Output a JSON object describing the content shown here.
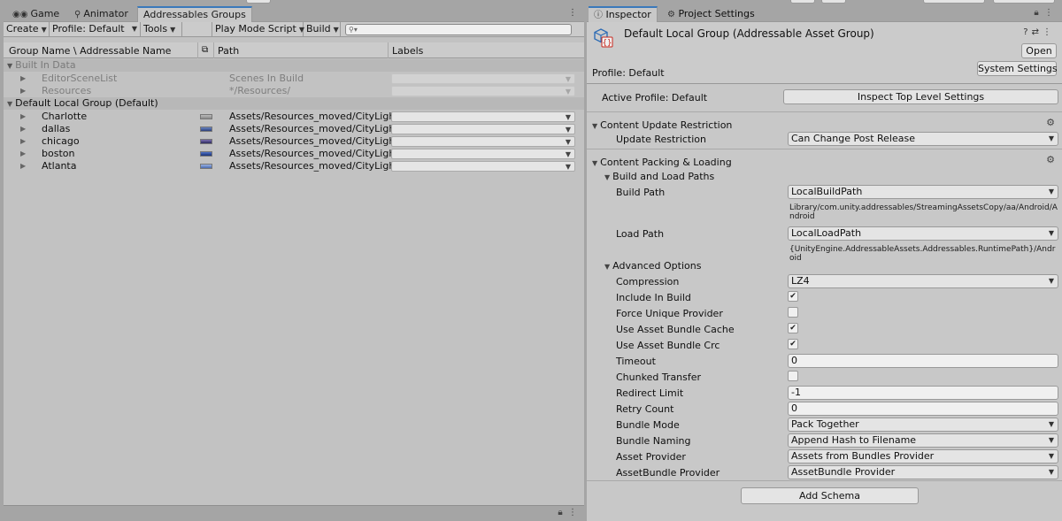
{
  "left_tabs": {
    "game": "Game",
    "animator": "Animator",
    "addressables": "Addressables Groups"
  },
  "toolbar": {
    "create": "Create",
    "profile": "Profile: Default",
    "tools": "Tools",
    "play_mode": "Play Mode Script",
    "build": "Build"
  },
  "columns": {
    "name": "Group Name \\ Addressable Name",
    "path": "Path",
    "labels": "Labels"
  },
  "groups": {
    "built_in": "Built In Data",
    "default_local": "Default Local Group (Default)"
  },
  "built_in_rows": [
    {
      "name": "EditorSceneList",
      "path": "Scenes In Build"
    },
    {
      "name": "Resources",
      "path": "*/Resources/"
    }
  ],
  "default_rows": [
    {
      "name": "Charlotte",
      "path": "Assets/Resources_moved/CityLight"
    },
    {
      "name": "dallas",
      "path": "Assets/Resources_moved/CityLight"
    },
    {
      "name": "chicago",
      "path": "Assets/Resources_moved/CityLight"
    },
    {
      "name": "boston",
      "path": "Assets/Resources_moved/CityLight"
    },
    {
      "name": "Atlanta",
      "path": "Assets/Resources_moved/CityLight"
    }
  ],
  "right_tabs": {
    "inspector": "Inspector",
    "project_settings": "Project Settings"
  },
  "inspector": {
    "title": "Default Local Group (Addressable Asset Group)",
    "open": "Open",
    "profile": "Profile: Default",
    "system_settings": "System Settings",
    "active_profile": "Active Profile: Default",
    "inspect_top": "Inspect Top Level Settings"
  },
  "content_update": {
    "title": "Content Update Restriction",
    "label": "Update Restriction",
    "value": "Can Change Post Release"
  },
  "packing": {
    "title": "Content Packing & Loading",
    "build_load_paths": "Build and Load Paths",
    "build_path_label": "Build Path",
    "build_path_value": "LocalBuildPath",
    "build_path_note": "Library/com.unity.addressables/StreamingAssetsCopy/aa/Android/Android",
    "load_path_label": "Load Path",
    "load_path_value": "LocalLoadPath",
    "load_path_note": "{UnityEngine.AddressableAssets.Addressables.RuntimePath}/Android",
    "advanced": "Advanced Options"
  },
  "advanced": {
    "compression_label": "Compression",
    "compression_value": "LZ4",
    "include_in_build": "Include In Build",
    "force_unique": "Force Unique Provider",
    "use_cache": "Use Asset Bundle Cache",
    "use_crc": "Use Asset Bundle Crc",
    "timeout_label": "Timeout",
    "timeout_value": "0",
    "chunked": "Chunked Transfer",
    "redirect_label": "Redirect Limit",
    "redirect_value": "-1",
    "retry_label": "Retry Count",
    "retry_value": "0",
    "bundle_mode_label": "Bundle Mode",
    "bundle_mode_value": "Pack Together",
    "bundle_naming_label": "Bundle Naming",
    "bundle_naming_value": "Append Hash to Filename",
    "asset_provider_label": "Asset Provider",
    "asset_provider_value": "Assets from Bundles Provider",
    "bundle_provider_label": "AssetBundle Provider",
    "bundle_provider_value": "AssetBundle Provider"
  },
  "add_schema": "Add Schema",
  "colors": {
    "tab_accent": "#3a79bb",
    "panel_bg": "#c2c2c2",
    "group_row": "#b8b8b8",
    "icon_red": "#c8261c",
    "icon_blue": "#2f6db5"
  },
  "icons": [
    "game-icon",
    "animator-icon",
    "info-icon",
    "gear-icon",
    "lock-icon",
    "kebab-menu-icon",
    "help-icon",
    "preset-icon",
    "search-icon",
    "addressable-group-icon"
  ]
}
